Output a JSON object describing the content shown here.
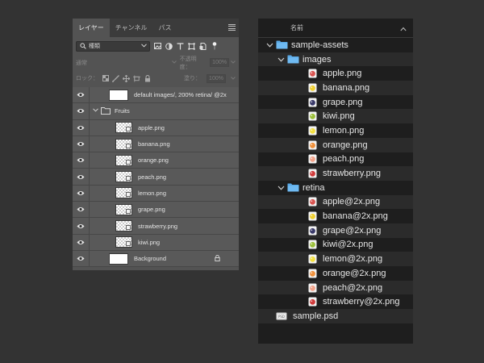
{
  "ps_panel": {
    "tabs": [
      "レイヤー",
      "チャンネル",
      "パス"
    ],
    "active_tab": 0,
    "filter": {
      "label": "種類"
    },
    "blend_mode": "通常",
    "opacity_label": "不透明度：",
    "opacity_value": "100%",
    "lock_label": "ロック：",
    "fill_label": "塗り：",
    "fill_value": "100%",
    "layers": [
      {
        "name": "default images/, 200% retina/ @2x",
        "kind": "plain",
        "indent": 0
      },
      {
        "name": "Fruits",
        "kind": "group",
        "indent": 0
      },
      {
        "name": "apple.png",
        "kind": "smart",
        "indent": 1
      },
      {
        "name": "banana.png",
        "kind": "smart",
        "indent": 1
      },
      {
        "name": "orange.png",
        "kind": "smart",
        "indent": 1
      },
      {
        "name": "peach.png",
        "kind": "smart",
        "indent": 1
      },
      {
        "name": "lemon.png",
        "kind": "smart",
        "indent": 1
      },
      {
        "name": "grape.png",
        "kind": "smart",
        "indent": 1
      },
      {
        "name": "strawberry.png",
        "kind": "smart",
        "indent": 1
      },
      {
        "name": "kiwi.png",
        "kind": "smart",
        "indent": 1
      },
      {
        "name": "Background",
        "kind": "background",
        "indent": 0
      }
    ]
  },
  "file_browser": {
    "column_header": "名前",
    "rows": [
      {
        "name": "sample-assets",
        "type": "folder",
        "level": 0,
        "expanded": true
      },
      {
        "name": "images",
        "type": "folder",
        "level": 1,
        "expanded": true
      },
      {
        "name": "apple.png",
        "type": "file",
        "level": 2,
        "color": "#d9534f"
      },
      {
        "name": "banana.png",
        "type": "file",
        "level": 2,
        "color": "#f0d030"
      },
      {
        "name": "grape.png",
        "type": "file",
        "level": 2,
        "color": "#3a3a6a"
      },
      {
        "name": "kiwi.png",
        "type": "file",
        "level": 2,
        "color": "#9bbf3a"
      },
      {
        "name": "lemon.png",
        "type": "file",
        "level": 2,
        "color": "#f3e040"
      },
      {
        "name": "orange.png",
        "type": "file",
        "level": 2,
        "color": "#f0903a"
      },
      {
        "name": "peach.png",
        "type": "file",
        "level": 2,
        "color": "#f3a38a"
      },
      {
        "name": "strawberry.png",
        "type": "file",
        "level": 2,
        "color": "#d03a3a"
      },
      {
        "name": "retina",
        "type": "folder",
        "level": 1,
        "expanded": true
      },
      {
        "name": "apple@2x.png",
        "type": "file",
        "level": 2,
        "color": "#d9534f"
      },
      {
        "name": "banana@2x.png",
        "type": "file",
        "level": 2,
        "color": "#f0d030"
      },
      {
        "name": "grape@2x.png",
        "type": "file",
        "level": 2,
        "color": "#3a3a6a"
      },
      {
        "name": "kiwi@2x.png",
        "type": "file",
        "level": 2,
        "color": "#9bbf3a"
      },
      {
        "name": "lemon@2x.png",
        "type": "file",
        "level": 2,
        "color": "#f3e040"
      },
      {
        "name": "orange@2x.png",
        "type": "file",
        "level": 2,
        "color": "#f0903a"
      },
      {
        "name": "peach@2x.png",
        "type": "file",
        "level": 2,
        "color": "#f3a38a"
      },
      {
        "name": "strawberry@2x.png",
        "type": "file",
        "level": 2,
        "color": "#d03a3a"
      },
      {
        "name": "sample.psd",
        "type": "psd",
        "level": 0
      }
    ]
  }
}
